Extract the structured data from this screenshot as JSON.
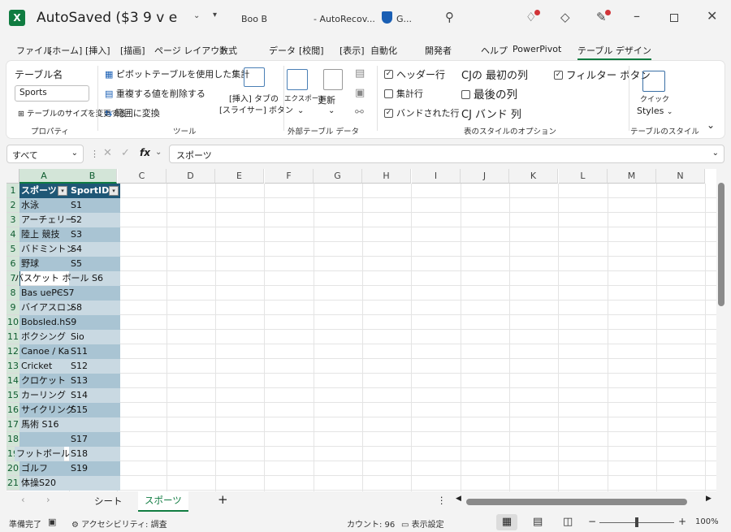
{
  "titlebar": {
    "app_icon": "X",
    "title": "AutoSaved ($3 9 v e",
    "user": "Boo B",
    "doc_name": "- AutoRecov...",
    "shield_label": "G...",
    "icons": [
      "chevron-down-icon",
      "dropdown-arrow-icon",
      "shield-icon",
      "search-icon",
      "lightbulb-icon",
      "diamond-icon",
      "pen-icon",
      "minimize-icon",
      "maximize-icon",
      "close-icon"
    ]
  },
  "tabs": {
    "file": "ファイル",
    "home": "[ホーム]",
    "insert": "[挿入]",
    "draw": "[描画]",
    "page_layout": "ページ レイアウト",
    "formulas": "数式",
    "data": "データ",
    "review": "[校閲]",
    "view": "[表示]",
    "automate": "自動化",
    "developer": "開発者",
    "help": "ヘルプ",
    "powerpivot": "PowerPivot",
    "table_design": "テーブル デザイン"
  },
  "ribbon": {
    "properties": {
      "table_name_label": "テーブル名",
      "table_name_value": "Sports",
      "resize_label": "テーブルのサイズを変更する",
      "group_label": "プロパティ"
    },
    "tools": {
      "pivot_label": "ピボットテーブルを使用した集計",
      "remove_dup_label": "重複する値を削除する",
      "convert_label": "範囲に変換",
      "slicer_label_1": "[挿入] タブの",
      "slicer_label_2": "[スライサー] ボタン",
      "group_label": "ツール"
    },
    "external": {
      "export_label": "エクスポート",
      "refresh_label": "更新",
      "group_label": "外部テーブル データ"
    },
    "style_options": {
      "header_row": "ヘッダー行",
      "total_row": "集計行",
      "banded_rows": "バンドされた行",
      "first_column": "CJの 最初の列",
      "last_column": "最後の列",
      "banded_columns": "CJ バンド 列",
      "filter_button": "フィルター ボタン",
      "group_label": "表のスタイルのオプション",
      "header_row_checked": true,
      "total_row_checked": false,
      "banded_rows_checked": true,
      "last_column_checked": false,
      "filter_button_checked": true
    },
    "styles": {
      "quick_label": "クイック",
      "styles_label": "Styles",
      "group_label": "テーブルのスタイル"
    }
  },
  "formulabar": {
    "namebox": "すべて",
    "fx": "fx",
    "content": "スポーツ"
  },
  "grid": {
    "columns": [
      "A",
      "B",
      "C",
      "D",
      "E",
      "F",
      "G",
      "H",
      "I",
      "J",
      "K",
      "L",
      "M",
      "N"
    ],
    "rows": [
      "1",
      "2",
      "3",
      "4",
      "5",
      "6",
      "7",
      "8",
      "9",
      "10",
      "11",
      "12",
      "13",
      "14",
      "15",
      "16",
      "17",
      "18",
      "19",
      "20",
      "21"
    ],
    "header": [
      "スポーツ",
      "SportID"
    ],
    "cells": [
      [
        "水泳",
        "S1"
      ],
      [
        "アーチェリー",
        "S2"
      ],
      [
        "陸上 競技",
        "S3"
      ],
      [
        "バドミントン",
        "S4"
      ],
      [
        "野球",
        "S5"
      ],
      [
        "バスケット ボール S6",
        ""
      ],
      [
        " Bas uePЄS7",
        ""
      ],
      [
        "バイアスロン",
        "S8"
      ],
      [
        " Bobsled.hS9",
        ""
      ],
      [
        "ボクシング",
        " Sio"
      ],
      [
        "Canoe / Ka",
        "S11"
      ],
      [
        "Cricket",
        "S12"
      ],
      [
        "クロケット",
        "S13"
      ],
      [
        "カーリング",
        "S14"
      ],
      [
        "サイクリング",
        "S15"
      ],
      [
        "馬術 S16",
        ""
      ],
      [
        "",
        "S17"
      ],
      [
        "フットボール",
        "S18"
      ],
      [
        "ゴルフ",
        "S19"
      ],
      [
        "体操S20",
        ""
      ]
    ],
    "colors": {
      "header": "#1f5776",
      "band_dark": "#a9c4d3",
      "band_light": "#c9d9e2"
    }
  },
  "sheets": {
    "tabs": [
      "シート",
      "スポーツ"
    ],
    "active": "スポーツ",
    "add": "+"
  },
  "status": {
    "ready": "準備完了",
    "accessibility": "アクセシビリティ: 調査",
    "count": "カウント: 96",
    "display_settings": "表示設定",
    "zoom": "100%",
    "zoom_minus": "−",
    "zoom_plus": "+"
  }
}
